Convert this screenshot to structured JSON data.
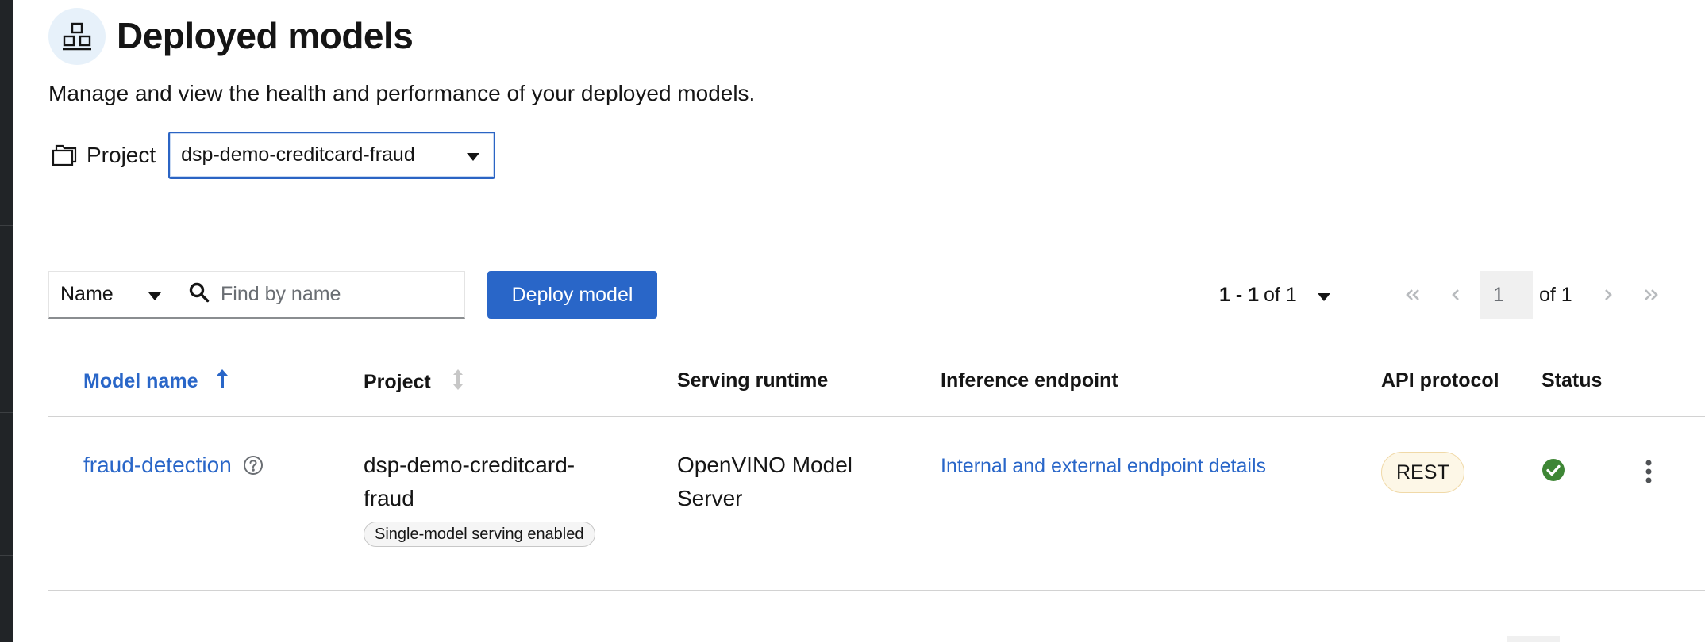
{
  "page": {
    "title": "Deployed models",
    "description": "Manage and view the health and performance of your deployed models.",
    "title_icon": "models-icon"
  },
  "project_selector": {
    "label": "Project",
    "icon": "project-icon",
    "selected": "dsp-demo-creditcard-fraud"
  },
  "toolbar": {
    "filter_attribute": "Name",
    "search_placeholder": "Find by name",
    "deploy_button": "Deploy model"
  },
  "pagination": {
    "range": "1 - 1",
    "of_total": "of 1",
    "current_page": "1",
    "page_total": "of 1"
  },
  "table": {
    "columns": [
      {
        "key": "model_name",
        "label": "Model name",
        "sorted": "asc"
      },
      {
        "key": "project",
        "label": "Project",
        "sortable": true
      },
      {
        "key": "serving_runtime",
        "label": "Serving runtime"
      },
      {
        "key": "inference_endpoint",
        "label": "Inference endpoint"
      },
      {
        "key": "api_protocol",
        "label": "API protocol"
      },
      {
        "key": "status",
        "label": "Status"
      }
    ],
    "rows": [
      {
        "model_name": "fraud-detection",
        "project": "dsp-demo-creditcard-fraud",
        "project_tag": "Single-model serving enabled",
        "serving_runtime": "OpenVINO Model Server",
        "inference_endpoint": "Internal and external endpoint details",
        "api_protocol": "REST",
        "status": "success"
      }
    ]
  },
  "colors": {
    "accent": "#2966c8",
    "success": "#3e8635",
    "rail": "#212427"
  }
}
